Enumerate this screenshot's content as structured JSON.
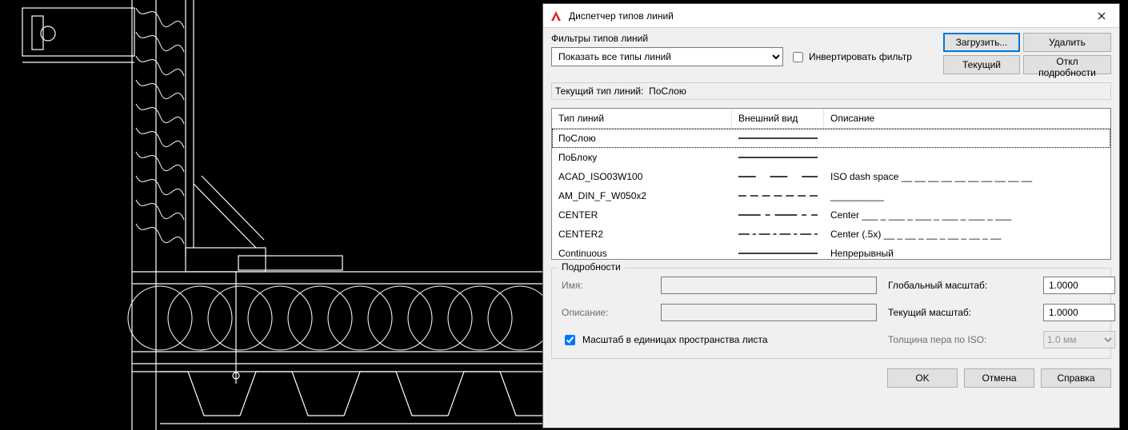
{
  "dialog": {
    "title": "Диспетчер типов линий",
    "filter_label": "Фильтры типов линий",
    "filter_value": "Показать все типы линий",
    "invert_label": "Инвертировать фильтр",
    "invert_checked": false,
    "buttons": {
      "load": "Загрузить...",
      "delete": "Удалить",
      "current": "Текущий",
      "toggle_details": "Откл подробности"
    },
    "current_linetype_label": "Текущий тип линий:",
    "current_linetype_value": "ПоСлою",
    "columns": {
      "name": "Тип линий",
      "appearance": "Внешний вид",
      "description": "Описание"
    },
    "rows": [
      {
        "name": "ПоСлою",
        "pattern": "solid",
        "desc": "",
        "selected": true
      },
      {
        "name": "ПоБлоку",
        "pattern": "solid",
        "desc": ""
      },
      {
        "name": "ACAD_ISO03W100",
        "pattern": "dash-space",
        "desc": "ISO dash space __ __ __ __ __ __ __ __ __ __"
      },
      {
        "name": "AM_DIN_F_W050x2",
        "pattern": "short-dash",
        "desc": "__________"
      },
      {
        "name": "CENTER",
        "pattern": "center",
        "desc": "Center ___ _ ___ _ ___ _ ___ _ ___ _ ___"
      },
      {
        "name": "CENTER2",
        "pattern": "center2",
        "desc": "Center (.5x) __ _ __ _ __ _ __ _ __ _ __"
      },
      {
        "name": "Continuous",
        "pattern": "solid",
        "desc": "Непрерывный"
      }
    ],
    "details": {
      "legend": "Подробности",
      "name_label": "Имя:",
      "name_value": "",
      "desc_label": "Описание:",
      "desc_value": "",
      "paperspace_label": "Масштаб в единицах пространства листа",
      "paperspace_checked": true,
      "global_scale_label": "Глобальный масштаб:",
      "global_scale_value": "1.0000",
      "current_scale_label": "Текущий масштаб:",
      "current_scale_value": "1.0000",
      "iso_pen_label": "Толщина пера по ISO:",
      "iso_pen_value": "1.0 мм"
    },
    "footer": {
      "ok": "OK",
      "cancel": "Отмена",
      "help": "Справка"
    }
  }
}
